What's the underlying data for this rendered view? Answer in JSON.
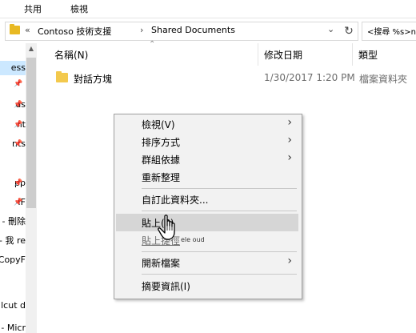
{
  "ribbon": {
    "tabs": [
      "共用",
      "檢視"
    ]
  },
  "address": {
    "overflow": "«",
    "crumbs": [
      "Contoso 技術支援",
      "Shared Documents"
    ],
    "separator": "›",
    "refresh_icon": "refresh-icon"
  },
  "search": {
    "placeholder": "搜尋 %s個",
    "display": "<搜尋 %s>n"
  },
  "nav": {
    "items": [
      {
        "label": "ess",
        "selected": true
      },
      {
        "label": "ds",
        "pinned": true
      },
      {
        "label": "nt",
        "pinned": true
      },
      {
        "label": "nts",
        "pinned": true
      },
      {
        "label": "pp",
        "pinned": true
      },
      {
        "label": "IF",
        "pinned": true
      },
      {
        "label": "- 刪除",
        "pinned": false
      },
      {
        "label": "- 我 re",
        "pinned": false
      },
      {
        "label": "CopyF",
        "pinned": false
      },
      {
        "label": "lcut d",
        "pinned": false
      },
      {
        "label": "- Micr",
        "pinned": false
      }
    ]
  },
  "columns": {
    "name": "名稱(N)",
    "date": "修改日期",
    "type": "類型"
  },
  "files": [
    {
      "name": "對話方塊",
      "date": "1/30/2017 1:20 PM",
      "type": "檔案資料夾"
    }
  ],
  "context_menu": {
    "groups": [
      [
        {
          "label": "檢視(V)",
          "submenu": true
        },
        {
          "label": "排序方式",
          "submenu": true
        },
        {
          "label": "群組依據",
          "submenu": true
        },
        {
          "label": "重新整理",
          "submenu": false
        }
      ],
      [
        {
          "label": "自訂此資料夾...",
          "submenu": false
        }
      ],
      [
        {
          "label": "貼上(P)",
          "submenu": false,
          "highlighted": true
        },
        {
          "label": "貼上捷徑",
          "submenu": false,
          "disabled": true
        }
      ],
      [
        {
          "label": "開新檔案",
          "submenu": true
        }
      ],
      [
        {
          "label": "摘要資訊(I)",
          "submenu": false
        }
      ]
    ],
    "overlay": "ele oud"
  },
  "colors": {
    "selection": "#cce8ff",
    "folder": "#f3c94d",
    "menu_bg": "#f2f2f2",
    "menu_highlight": "#d6d6d6"
  }
}
